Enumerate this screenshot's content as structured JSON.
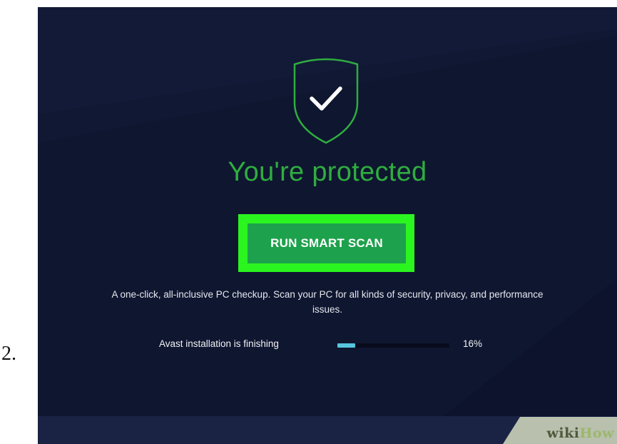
{
  "step_number": "2.",
  "app": {
    "status_heading": "You're protected",
    "status_icon": "shield-check-icon",
    "scan_button_label": "RUN SMART SCAN",
    "description": "A one-click, all-inclusive PC checkup. Scan your PC for all kinds of security, privacy, and performance issues.",
    "installation": {
      "label": "Avast installation is finishing",
      "progress_percent": 16,
      "progress_text": "16%"
    }
  },
  "watermark": {
    "prefix": "wiki",
    "suffix": "How"
  },
  "colors": {
    "background": "#0f1630",
    "accent_green": "#2fad3f",
    "button_green": "#1ea14c",
    "highlight_green": "#2bf51f",
    "progress_fill": "#56c6de"
  }
}
